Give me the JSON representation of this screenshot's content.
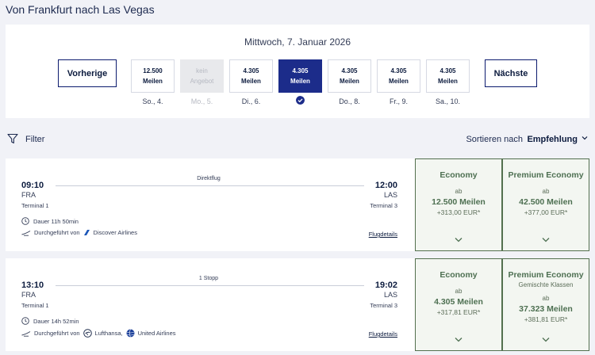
{
  "page_title": "Von Frankfurt nach Las Vegas",
  "date_selector": {
    "heading": "Mittwoch, 7. Januar 2026",
    "prev_label": "Vorherige",
    "next_label": "Nächste",
    "days": [
      {
        "line1": "12.500",
        "line2": "Meilen",
        "label": "So., 4."
      },
      {
        "line1": "kein",
        "line2": "Angebot",
        "label": "Mo., 5."
      },
      {
        "line1": "4.305",
        "line2": "Meilen",
        "label": "Di., 6."
      },
      {
        "line1": "4.305",
        "line2": "Meilen",
        "label": ""
      },
      {
        "line1": "4.305",
        "line2": "Meilen",
        "label": "Do., 8."
      },
      {
        "line1": "4.305",
        "line2": "Meilen",
        "label": "Fr., 9."
      },
      {
        "line1": "4.305",
        "line2": "Meilen",
        "label": "Sa., 10."
      }
    ]
  },
  "toolbar": {
    "filter_label": "Filter",
    "sort_label": "Sortieren nach",
    "sort_value": "Empfehlung"
  },
  "flights": [
    {
      "dep_time": "09:10",
      "arr_time": "12:00",
      "stops": "Direktflug",
      "dep_code": "FRA",
      "arr_code": "LAS",
      "dep_terminal": "Terminal 1",
      "arr_terminal": "Terminal 3",
      "duration": "Dauer 11h 50min",
      "operated_prefix": "Durchgeführt von",
      "airline1": "Discover Airlines",
      "airline2": "",
      "details_label": "Flugdetails",
      "fare_eco": {
        "title": "Economy",
        "sub": "",
        "ab": "ab",
        "miles": "12.500 Meilen",
        "eur": "+313,00 EUR*"
      },
      "fare_prem": {
        "title": "Premium Economy",
        "sub": "",
        "ab": "ab",
        "miles": "42.500 Meilen",
        "eur": "+377,00 EUR*"
      }
    },
    {
      "dep_time": "13:10",
      "arr_time": "19:02",
      "stops": "1 Stopp",
      "dep_code": "FRA",
      "arr_code": "LAS",
      "dep_terminal": "Terminal 1",
      "arr_terminal": "Terminal 3",
      "duration": "Dauer 14h 52min",
      "operated_prefix": "Durchgeführt von",
      "airline1": "Lufthansa,",
      "airline2": "United Airlines",
      "details_label": "Flugdetails",
      "fare_eco": {
        "title": "Economy",
        "sub": "",
        "ab": "ab",
        "miles": "4.305 Meilen",
        "eur": "+317,81 EUR*"
      },
      "fare_prem": {
        "title": "Premium Economy",
        "sub": "Gemischte Klassen",
        "ab": "ab",
        "miles": "37.323 Meilen",
        "eur": "+381,81 EUR*"
      }
    }
  ]
}
